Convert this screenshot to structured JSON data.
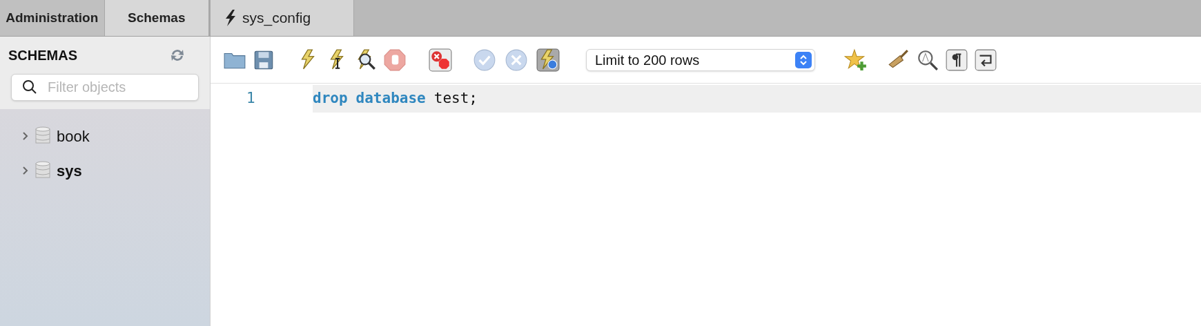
{
  "side_tabs": [
    {
      "label": "Administration",
      "selected": false
    },
    {
      "label": "Schemas",
      "selected": true
    }
  ],
  "editor_tabs": [
    {
      "label": "sys_config",
      "selected": true
    }
  ],
  "sidebar": {
    "title": "SCHEMAS",
    "filter": {
      "placeholder": "Filter objects"
    },
    "schemas": [
      {
        "name": "book",
        "default": false,
        "expanded": false
      },
      {
        "name": "sys",
        "default": true,
        "expanded": false
      }
    ]
  },
  "toolbar": {
    "limit": {
      "value": "Limit to 200 rows"
    }
  },
  "editor": {
    "lines": [
      {
        "number": "1",
        "current": true,
        "tokens": [
          {
            "text": "drop",
            "kind": "keyword"
          },
          {
            "text": "database",
            "kind": "keyword"
          },
          {
            "text": "test;",
            "kind": "plain"
          }
        ]
      }
    ]
  }
}
